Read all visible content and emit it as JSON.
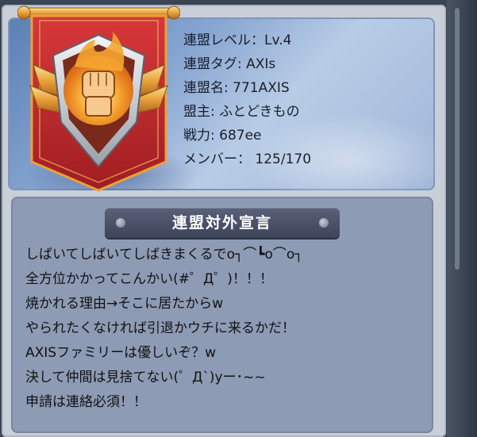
{
  "alliance": {
    "level": "連盟レベル：Lv.4",
    "tag": "連盟タグ: AXIs",
    "name": "連盟名: 771AXIS",
    "leader": "盟主: ふとどきもの",
    "power": "戦力: 687ee",
    "members": "メンバー： 125/170"
  },
  "declaration": {
    "title": "連盟対外宣言",
    "lines": [
      "しばいてしばいてしばきまくるでo┐⌒┗o⌒o┐",
      "全方位かかってこんかい(#゜Д゜)！！！",
      "焼かれる理由→そこに居たからw",
      "やられたくなければ引退かウチに来るかだ！",
      "AXISファミリーは優しいぞ？w",
      "決して仲間は見捨てない(゜Д`)yー･~~",
      "申請は連絡必須！！"
    ]
  },
  "colors": {
    "banner_red": "#c4282c",
    "emblem_gold": "#e8a23a",
    "panel_blue": "#86a5d1",
    "declaration_bg": "#8e9bb5"
  },
  "icons": {
    "emblem": "raised-fist-icon"
  }
}
